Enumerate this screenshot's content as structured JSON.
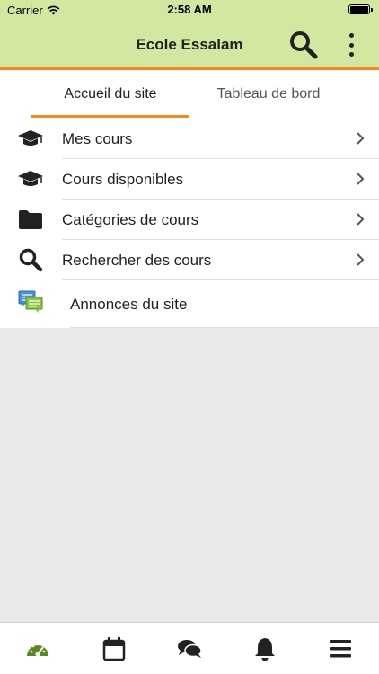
{
  "status": {
    "carrier": "Carrier",
    "time": "2:58 AM"
  },
  "header": {
    "title": "Ecole Essalam"
  },
  "tabs": [
    {
      "label": "Accueil du site",
      "active": true
    },
    {
      "label": "Tableau de bord",
      "active": false
    }
  ],
  "menu": [
    {
      "label": "Mes cours",
      "icon": "graduation-cap-icon"
    },
    {
      "label": "Cours disponibles",
      "icon": "graduation-cap-icon"
    },
    {
      "label": "Catégories de cours",
      "icon": "folder-icon"
    },
    {
      "label": "Rechercher des cours",
      "icon": "search-icon"
    },
    {
      "label": "Annonces du site",
      "icon": "chat-bubbles-icon"
    }
  ],
  "bottom_nav": [
    {
      "name": "dashboard-icon"
    },
    {
      "name": "calendar-icon"
    },
    {
      "name": "messages-icon"
    },
    {
      "name": "notifications-bell-icon"
    },
    {
      "name": "menu-hamburger-icon"
    }
  ],
  "colors": {
    "accent": "#f08c1a",
    "header_bg": "#d2e8a0",
    "active_nav": "#5a8a1e"
  }
}
